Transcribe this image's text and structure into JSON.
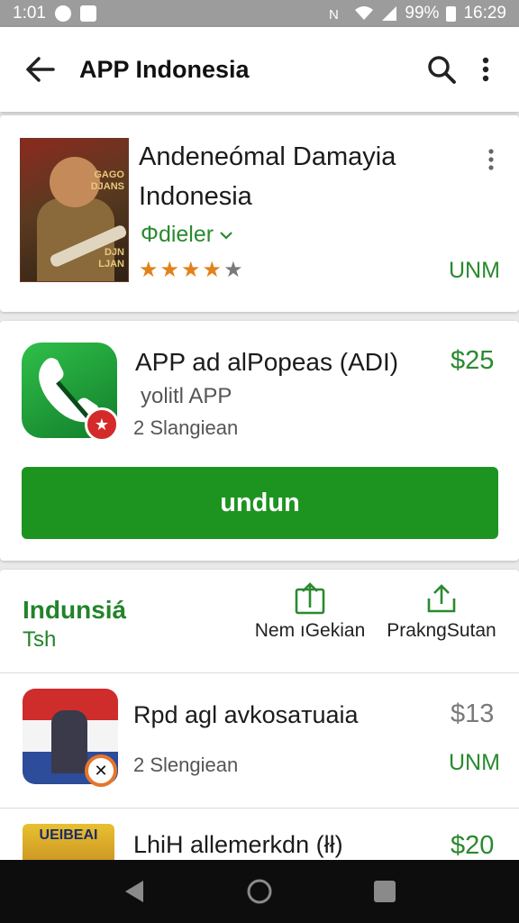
{
  "status_bar": {
    "time": "1:01",
    "battery": "99%",
    "clock": "16:29"
  },
  "app_bar": {
    "title": "APP Indonesia"
  },
  "featured": {
    "title": "Andeneómal Damayia Indonesia",
    "cover_text": "GAGO\nDJANS",
    "cover_text_lower": "DJN\nLJAN",
    "publisher": "Φdieler",
    "rating": 4,
    "rating_max": 5,
    "price": "UNM"
  },
  "app_card": {
    "name": "APP ad alPopeas (ΑDI)",
    "price": "$25",
    "subtitle": "yolitl APP",
    "meta": "2 Slangiean",
    "install_label": "undun"
  },
  "section": {
    "title": "Indunsiá",
    "subtitle": "Tsh",
    "action_a_label": "Nem ıGekian",
    "action_b_label": "PrakngSutan"
  },
  "list": [
    {
      "name": "Rpd agl avkosaтuaia",
      "price": "$13",
      "meta": "2 Slengiean",
      "status": "UNM"
    },
    {
      "name": "LhiH allemerkdn (łł)",
      "price": "$20",
      "icon_text": "UEIBEAI"
    }
  ],
  "colors": {
    "accent_green": "#1d9420",
    "text_green": "#2a8a2e",
    "star": "#e2821a"
  },
  "icons": {
    "back": "arrow-left",
    "search": "magnifier",
    "more": "vertical-dots",
    "share": "share-up",
    "nav_back": "triangle-left",
    "nav_home": "circle",
    "nav_recent": "square"
  }
}
